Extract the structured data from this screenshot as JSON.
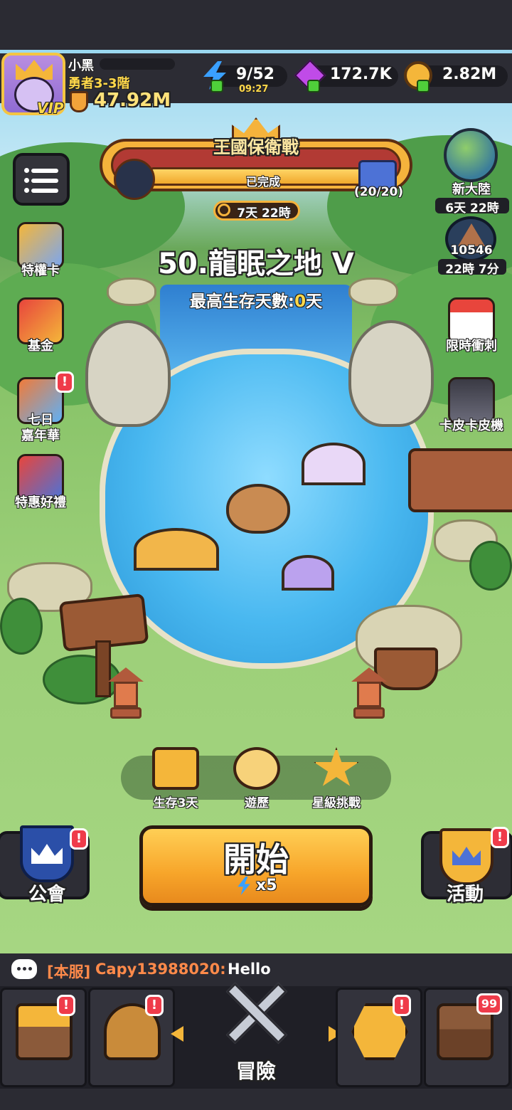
{
  "player": {
    "name": "小黑",
    "rank": "勇者3-3階",
    "power": "47.92M",
    "vip_label": "VIP"
  },
  "resources": {
    "energy": {
      "value": "9/52",
      "timer": "09:27",
      "icon": "lightning-icon",
      "color": "#3aa0ff"
    },
    "gems": {
      "value": "172.7K",
      "icon": "gem-icon",
      "color": "#c04be8"
    },
    "coins": {
      "value": "2.82M",
      "icon": "coin-icon",
      "color": "#f4b63a"
    }
  },
  "kingdom_event": {
    "title": "王國保衛戰",
    "status": "已完成",
    "progress": "(20/20)",
    "progress_fraction": 1.0,
    "timer": "7天 22時"
  },
  "level": {
    "title": "50.龍眠之地 V",
    "survival_prefix": "最高生存天數:",
    "survival_days": "0",
    "survival_suffix": "天"
  },
  "left_menu": [
    {
      "label": "特權卡",
      "icon": "privilege-card-icon",
      "badge": false
    },
    {
      "label": "基金",
      "icon": "fund-chart-icon",
      "badge": false
    },
    {
      "label": "七日\n嘉年華",
      "label_line1": "七日",
      "label_line2": "嘉年華",
      "icon": "party-popper-icon",
      "badge": true
    },
    {
      "label": "特惠好禮",
      "icon": "gift-box-icon",
      "badge": false
    }
  ],
  "right_menu": {
    "new_continent": {
      "label": "新大陸",
      "timer": "6天 22時",
      "icon": "globe-icon"
    },
    "ranking": {
      "value": "10546",
      "timer": "22時 7分",
      "icon": "pyramid-icon"
    },
    "limited_rush": {
      "label": "限時衝刺",
      "icon": "calendar-icon"
    },
    "skin_machine": {
      "label": "卡皮卡皮機",
      "icon": "slot-machine-icon"
    }
  },
  "features": [
    {
      "label": "生存3天",
      "icon": "treasure-chest-icon"
    },
    {
      "label": "遊歷",
      "icon": "compass-icon"
    },
    {
      "label": "星級挑戰",
      "icon": "star-challenge-icon"
    }
  ],
  "start_button": {
    "label": "開始",
    "cost": "x5",
    "icon": "lightning-icon"
  },
  "guild": {
    "label": "公會",
    "badge": "!",
    "icon": "guild-crown-icon"
  },
  "activity": {
    "label": "活動",
    "badge": "!",
    "icon": "activity-crown-icon"
  },
  "chat": {
    "channel": "[本服]",
    "user": "Capy13988020:",
    "message": "Hello",
    "icon": "chat-bubble-icon"
  },
  "bottom_nav": [
    {
      "name": "shop",
      "icon": "shop-icon",
      "badge": "!"
    },
    {
      "name": "equipment",
      "icon": "helmet-icon",
      "badge": "!"
    },
    {
      "name": "adventure",
      "label": "冒險",
      "icon": "crossed-swords-icon"
    },
    {
      "name": "upgrade",
      "icon": "upgrade-arrow-icon",
      "badge": "!"
    },
    {
      "name": "chest",
      "icon": "treasure-chest-icon",
      "badge": "99"
    }
  ]
}
